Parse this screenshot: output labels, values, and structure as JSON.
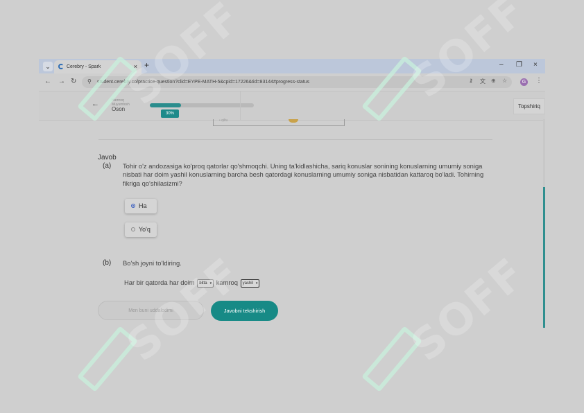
{
  "browser": {
    "tab_title": "Cerebry - Spark",
    "tab_close": "×",
    "new_tab": "+",
    "minimize": "–",
    "restore": "❐",
    "close": "×",
    "url": "student.cerebry.co/practice-question?clid=EYPE-MATH-5&cpid=17226&tid=83144#progress-status"
  },
  "header": {
    "subtitle_line1": "Hamroq",
    "subtitle_line2": "Muyumtosh",
    "topic": "Oson",
    "progress_percent": 30,
    "progress_label": "30%",
    "submit_label": "Topshiriq"
  },
  "figure": {
    "label": "• qiltu"
  },
  "content": {
    "answer_heading": "Javob",
    "part_a": {
      "letter": "(a)",
      "question": "Tohir o'z andozasiga ko'proq qatorlar qo'shmoqchi. Uning ta'kidlashicha, sariq konuslar sonining konuslarning umumiy soniga nisbati har doim yashil konuslarning barcha besh qatordagi konuslarning umumiy soniga nisbatidan kattaroq bo'ladi. Tohirning fikriga qo'shilasizmi?",
      "options": [
        {
          "label": "Ha",
          "selected": true
        },
        {
          "label": "Yo'q",
          "selected": false
        }
      ]
    },
    "part_b": {
      "letter": "(b)",
      "instruction": "Bo'sh joyni to'ldiring.",
      "sentence_start": "Har bir qatorda har doim",
      "select1_value": "bitta",
      "sentence_mid": "kamroq",
      "select2_value": "yashil"
    }
  },
  "actions": {
    "dont_know_label": "Men buni uddalodimi",
    "check_label": "Javobni tekshirish"
  },
  "watermark": {
    "text": "SOFF"
  },
  "colors": {
    "accent": "#178a86",
    "progress": "#2a8d8d"
  }
}
